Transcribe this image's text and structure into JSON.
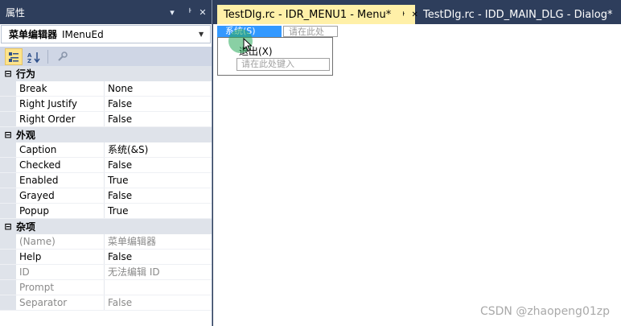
{
  "properties_panel": {
    "title": "属性",
    "object_name": "菜单编辑器",
    "object_type": "IMenuEd",
    "categories": [
      {
        "name": "行为",
        "rows": [
          {
            "name": "Break",
            "value": "None"
          },
          {
            "name": "Right Justify",
            "value": "False"
          },
          {
            "name": "Right Order",
            "value": "False"
          }
        ]
      },
      {
        "name": "外观",
        "rows": [
          {
            "name": "Caption",
            "value": "系统(&S)"
          },
          {
            "name": "Checked",
            "value": "False"
          },
          {
            "name": "Enabled",
            "value": "True"
          },
          {
            "name": "Grayed",
            "value": "False"
          },
          {
            "name": "Popup",
            "value": "True"
          }
        ]
      },
      {
        "name": "杂项",
        "rows": [
          {
            "name": "(Name)",
            "value": "菜单编辑器"
          },
          {
            "name": "Help",
            "value": "False"
          },
          {
            "name": "ID",
            "value": "无法编辑 ID"
          },
          {
            "name": "Prompt",
            "value": ""
          },
          {
            "name": "Separator",
            "value": "False"
          }
        ]
      }
    ]
  },
  "tabs": {
    "menu": "TestDlg.rc - IDR_MENU1 - Menu*",
    "dialog": "TestDlg.rc - IDD_MAIN_DLG - Dialog*"
  },
  "menu_editor": {
    "top_item": "系统(S)",
    "top_placeholder": "请在此处键入",
    "submenu_item": "退出(X)",
    "submenu_placeholder": "请在此处键入"
  },
  "watermark": "CSDN @zhaopeng01zp",
  "colors": {
    "header_bg": "#2e3e5c",
    "active_tab_bg": "#fff0a8",
    "menu_selected_bg": "#3399ff",
    "category_bg": "#dfe3ea"
  }
}
